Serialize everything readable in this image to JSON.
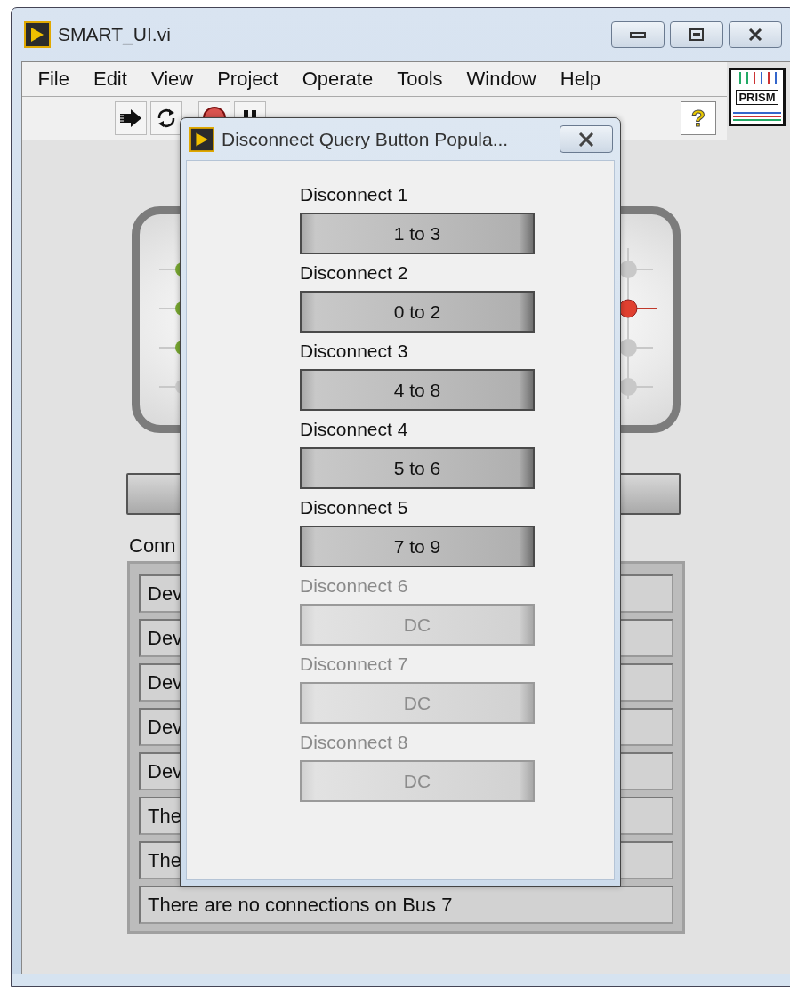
{
  "window": {
    "title": "SMART_UI.vi"
  },
  "menu": [
    "File",
    "Edit",
    "View",
    "Project",
    "Operate",
    "Tools",
    "Window",
    "Help"
  ],
  "toolbar": {
    "help": "?"
  },
  "logo": "PRISM",
  "indicators": {
    "left": [
      {
        "lit": true
      },
      {
        "lit": true
      },
      {
        "lit": true
      },
      {
        "lit": false
      }
    ],
    "right": [
      {
        "lit": false
      },
      {
        "lit": true
      },
      {
        "lit": false
      },
      {
        "lit": false
      }
    ]
  },
  "list_label": "Conn",
  "rows": [
    "Dev",
    "Dev",
    "Dev",
    "Dev",
    "Dev",
    "The",
    "The",
    "There are no connections on Bus 7"
  ],
  "dialog": {
    "title": "Disconnect Query Button Popula...",
    "items": [
      {
        "label": "Disconnect 1",
        "button": "1 to 3",
        "disabled": false
      },
      {
        "label": "Disconnect 2",
        "button": "0 to 2",
        "disabled": false
      },
      {
        "label": "Disconnect 3",
        "button": "4 to 8",
        "disabled": false
      },
      {
        "label": "Disconnect 4",
        "button": "5 to 6",
        "disabled": false
      },
      {
        "label": "Disconnect 5",
        "button": "7 to 9",
        "disabled": false
      },
      {
        "label": "Disconnect 6",
        "button": "DC",
        "disabled": true
      },
      {
        "label": "Disconnect 7",
        "button": "DC",
        "disabled": true
      },
      {
        "label": "Disconnect 8",
        "button": "DC",
        "disabled": true
      }
    ]
  }
}
